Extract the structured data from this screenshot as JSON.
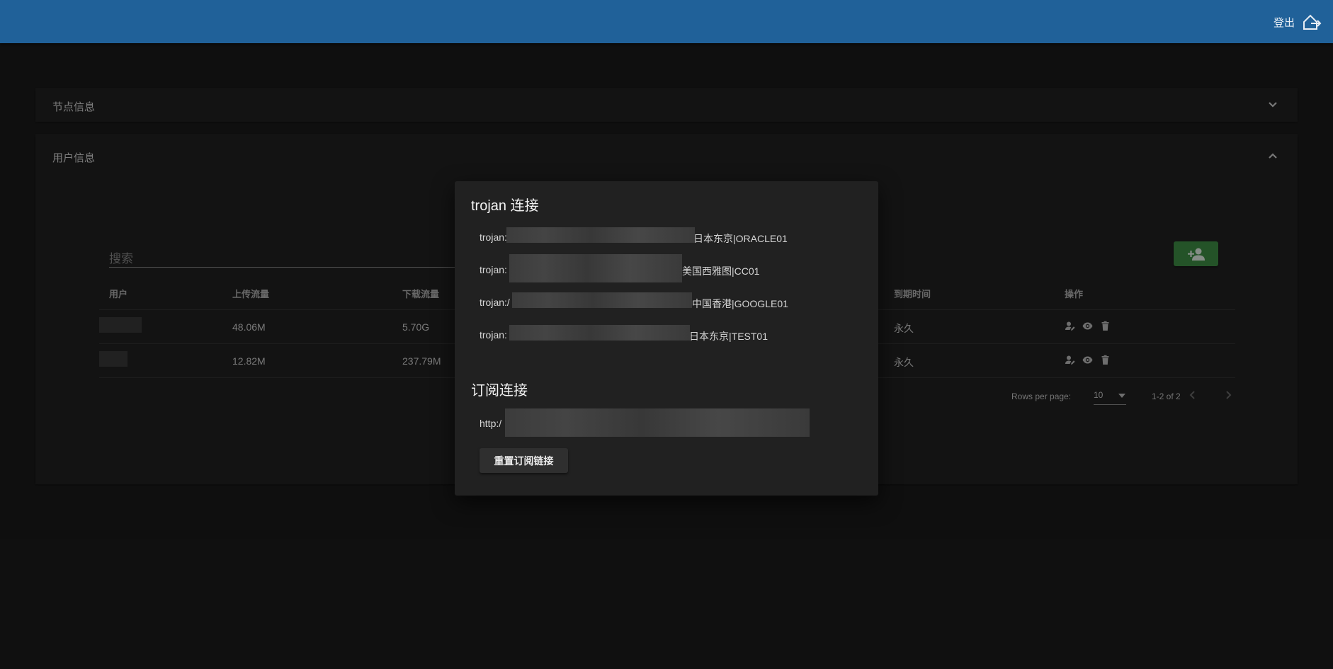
{
  "header": {
    "logout_label": "登出"
  },
  "panels": {
    "node_title": "节点信息",
    "user_title": "用户信息"
  },
  "users": {
    "search_placeholder": "搜索",
    "columns": {
      "user": "用户",
      "upload": "上传流量",
      "download": "下载流量",
      "expire": "到期时间",
      "actions": "操作"
    },
    "rows": [
      {
        "upload": "48.06M",
        "download": "5.70G",
        "expire": "永久"
      },
      {
        "upload": "12.82M",
        "download": "237.79M",
        "expire": "永久"
      }
    ],
    "pagination": {
      "rows_per_page_label": "Rows per page:",
      "rows_per_page": "10",
      "range": "1-2 of 2"
    }
  },
  "dialog": {
    "title": "trojan 连接",
    "links": [
      {
        "prefix": "trojan:",
        "suffix": "日本东京|ORACLE01"
      },
      {
        "prefix": "trojan:",
        "suffix": "美国西雅图|CC01"
      },
      {
        "prefix": "trojan:/",
        "suffix": "中国香港|GOOGLE01"
      },
      {
        "prefix": "trojan:",
        "suffix": "日本东京|TEST01"
      }
    ],
    "subscribe_title": "订阅连接",
    "subscribe_prefix": "http:/",
    "reset_label": "重置订阅链接"
  },
  "colors": {
    "appbar": "#206199",
    "add_button": "#3f8f45"
  }
}
